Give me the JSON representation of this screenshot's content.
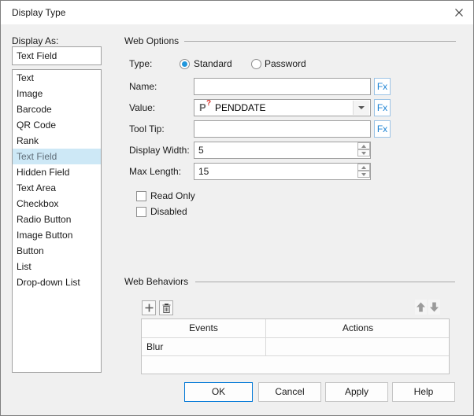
{
  "dialog": {
    "title": "Display Type"
  },
  "left_panel": {
    "label": "Display As:",
    "current_value": "Text Field",
    "items": [
      "Text",
      "Image",
      "Barcode",
      "QR Code",
      "Rank",
      "Text Field",
      "Hidden Field",
      "Text Area",
      "Checkbox",
      "Radio Button",
      "Image Button",
      "Button",
      "List",
      "Drop-down List"
    ],
    "selected_item": "Text Field",
    "selected_index": 5
  },
  "web_options": {
    "section_title": "Web Options",
    "type_label": "Type:",
    "type_options": [
      {
        "label": "Standard",
        "selected": true
      },
      {
        "label": "Password",
        "selected": false
      }
    ],
    "fx_label": "Fx",
    "fields": {
      "name": {
        "label": "Name:",
        "value": ""
      },
      "value": {
        "label": "Value:",
        "value": "PENDDATE",
        "icon_glyph": "P",
        "icon_badge": "?"
      },
      "tooltip": {
        "label": "Tool Tip:",
        "value": ""
      },
      "display_width": {
        "label": "Display Width:",
        "value": "5"
      },
      "max_length": {
        "label": "Max Length:",
        "value": "15"
      }
    },
    "checkboxes": [
      {
        "label": "Read Only",
        "checked": false
      },
      {
        "label": "Disabled",
        "checked": false
      }
    ]
  },
  "web_behaviors": {
    "section_title": "Web Behaviors",
    "table": {
      "columns": [
        "Events",
        "Actions"
      ],
      "rows": [
        {
          "event": "Blur",
          "action": ""
        }
      ]
    }
  },
  "footer": {
    "buttons": [
      "OK",
      "Cancel",
      "Apply",
      "Help"
    ],
    "default_button": "OK"
  },
  "colors": {
    "dialog_bg": "#f0f0f0",
    "titlebar_bg": "#ffffff",
    "selection_bg": "#cde8f6",
    "accent_blue": "#0078d7",
    "fx_blue": "#1d83d4",
    "badge_red": "#d9342b"
  }
}
